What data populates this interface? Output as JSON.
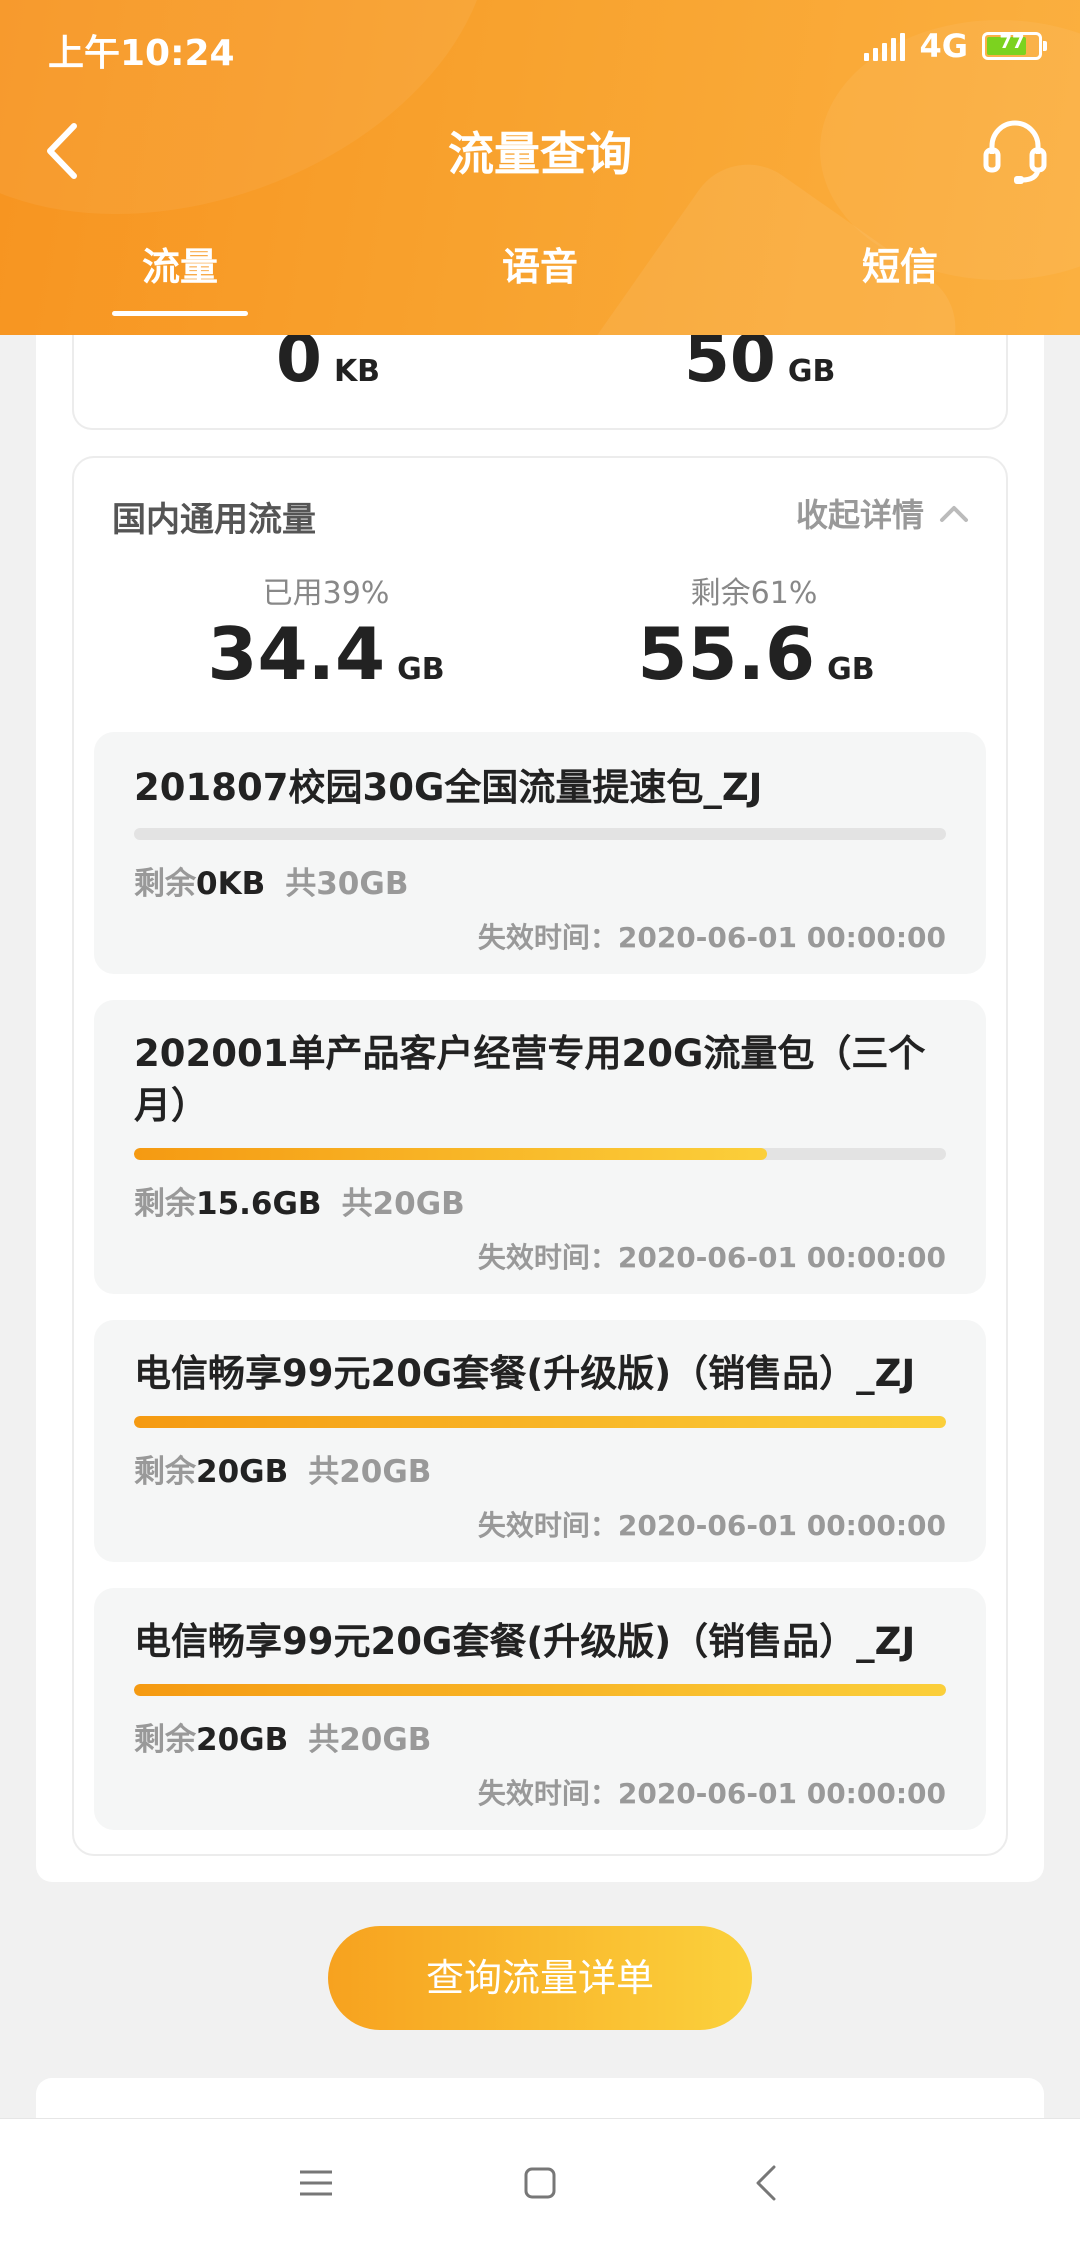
{
  "status_bar": {
    "time": "上午10:24",
    "network": "4G",
    "battery": "77"
  },
  "header": {
    "title": "流量查询",
    "back_icon": "chevron-left-icon",
    "service_icon": "headset-icon"
  },
  "tabs": [
    {
      "label": "流量",
      "active": true
    },
    {
      "label": "语音",
      "active": false
    },
    {
      "label": "短信",
      "active": false
    }
  ],
  "summary": {
    "left": {
      "value": "0",
      "unit": "KB"
    },
    "right": {
      "value": "50",
      "unit": "GB"
    }
  },
  "domestic": {
    "title": "国内通用流量",
    "collapse_label": "收起详情",
    "used_label": "已用39%",
    "used_value": "34.4",
    "used_unit": "GB",
    "remain_label": "剩余61%",
    "remain_value": "55.6",
    "remain_unit": "GB"
  },
  "packages": [
    {
      "name": "201807校园30G全国流量提速包_ZJ",
      "remain_prefix": "剩余",
      "remain": "0KB",
      "total": "共30GB",
      "expire": "失效时间：2020-06-01 00:00:00",
      "remaining_fraction": 0
    },
    {
      "name": "202001单产品客户经营专用20G流量包（三个月）",
      "remain_prefix": "剩余",
      "remain": "15.6GB",
      "total": "共20GB",
      "expire": "失效时间：2020-06-01 00:00:00",
      "remaining_fraction": 0.78
    },
    {
      "name": "电信畅享99元20G套餐(升级版)（销售品）_ZJ",
      "remain_prefix": "剩余",
      "remain": "20GB",
      "total": "共20GB",
      "expire": "失效时间：2020-06-01 00:00:00",
      "remaining_fraction": 1
    },
    {
      "name": "电信畅享99元20G套餐(升级版)（销售品）_ZJ",
      "remain_prefix": "剩余",
      "remain": "20GB",
      "total": "共20GB",
      "expire": "失效时间：2020-06-01 00:00:00",
      "remaining_fraction": 1
    }
  ],
  "query_button": "查询流量详单",
  "colors": {
    "header_orange": "#f79420",
    "accent_yellow": "#fbd13c",
    "battery_green": "#7cd21f"
  },
  "system_nav": {
    "menu_icon": "menu-icon",
    "home_icon": "home-square-icon",
    "back_icon": "back-triangle-icon"
  }
}
